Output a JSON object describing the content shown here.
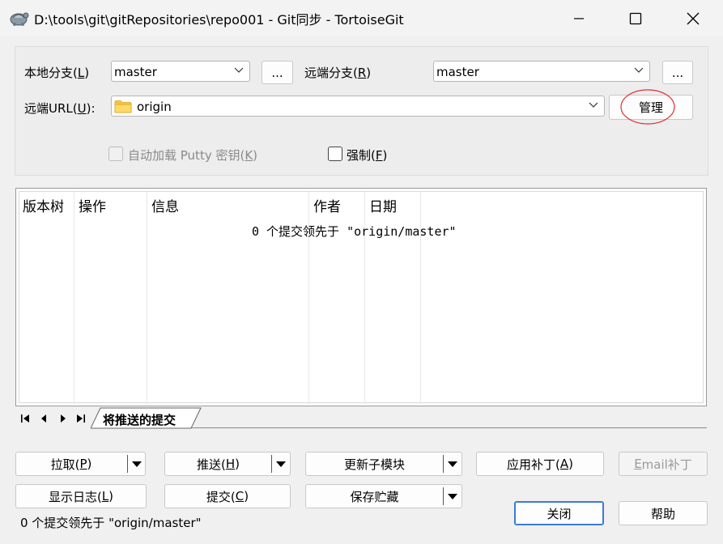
{
  "window": {
    "title": "D:\\tools\\git\\gitRepositories\\repo001 - Git同步 - TortoiseGit",
    "minimize_icon": "minimize-icon",
    "maximize_icon": "maximize-icon",
    "close_icon": "close-icon"
  },
  "local_branch": {
    "label": "本地分支(",
    "key": "L",
    "label_end": ")",
    "value": "master",
    "browse_label": "..."
  },
  "remote_branch": {
    "label": "远端分支(",
    "key": "R",
    "label_end": ")",
    "value": "master",
    "browse_label": "..."
  },
  "remote_url": {
    "label": "远端URL(",
    "key": "U",
    "label_end": "):",
    "value": "origin",
    "manage_label": "管理",
    "folder_icon": "folder-icon"
  },
  "options": {
    "putty": {
      "label": "自动加载 Putty 密钥(",
      "key": "K",
      "label_end": ")",
      "checked": false,
      "enabled": false
    },
    "force": {
      "label": "强制(",
      "key": "F",
      "label_end": ")",
      "checked": false,
      "enabled": true
    }
  },
  "commit_list": {
    "columns": [
      "版本树",
      "操作",
      "信息",
      "作者",
      "日期"
    ],
    "empty_message": "0 个提交领先于 \"origin/master\""
  },
  "tabs": {
    "active_tab": "将推送的提交"
  },
  "buttons": {
    "pull": {
      "label": "拉取(",
      "key": "P",
      "end": ")"
    },
    "push": {
      "label": "推送(",
      "key": "H",
      "end": ")"
    },
    "update_submodules": {
      "label": "更新子模块"
    },
    "apply_patch": {
      "label": "应用补丁(",
      "key": "A",
      "end": ")"
    },
    "email_patch": {
      "label_e": "E",
      "label": "mail补丁"
    },
    "show_log": {
      "label": "显示日志(",
      "key": "L",
      "end": ")"
    },
    "commit": {
      "label": "提交(",
      "key": "C",
      "end": ")"
    },
    "stash_save": {
      "label": "保存贮藏"
    },
    "close": {
      "label": "关闭"
    },
    "help": {
      "label": "帮助"
    }
  },
  "status_text": "0 个提交领先于 \"origin/master\"",
  "colors": {
    "annotation_circle": "#e03030",
    "default_button_border": "#3a7bd5"
  }
}
